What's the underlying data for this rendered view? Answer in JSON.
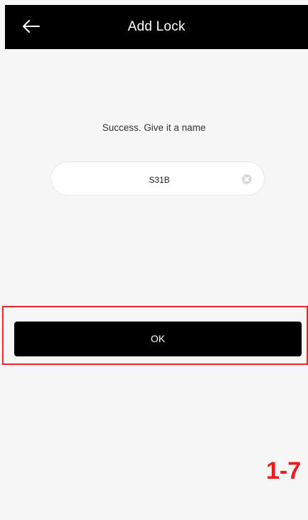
{
  "header": {
    "title": "Add Lock",
    "back_icon": "arrow-left-icon"
  },
  "main": {
    "message": "Success. Give it a name",
    "name_input": {
      "value": "S31B",
      "clear_icon": "clear-circle-icon"
    },
    "ok_label": "OK"
  },
  "annotation": {
    "figure_label": "1-7",
    "highlight_color": "#e8252b"
  }
}
